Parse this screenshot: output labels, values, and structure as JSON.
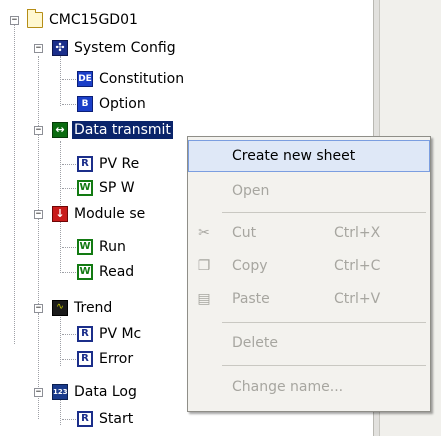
{
  "tree": {
    "root": {
      "label": "CMC15GD01",
      "icon": "folder-icon"
    },
    "nodes": [
      {
        "label": "System Config",
        "icon": "system-config-icon"
      },
      {
        "label": "Constitution",
        "icon": "constitution-icon"
      },
      {
        "label": "Option",
        "icon": "option-icon"
      },
      {
        "label": "Data transmit",
        "icon": "data-transmit-icon"
      },
      {
        "label": "PV Re",
        "icon": "read-icon",
        "badge": "R"
      },
      {
        "label": "SP W",
        "icon": "write-icon",
        "badge": "W"
      },
      {
        "label": "Module se",
        "icon": "module-icon"
      },
      {
        "label": "Run",
        "icon": "write-icon",
        "badge": "W"
      },
      {
        "label": "Read",
        "icon": "write-icon",
        "badge": "W"
      },
      {
        "label": "Trend",
        "icon": "trend-icon"
      },
      {
        "label": "PV Mc",
        "icon": "read-icon",
        "badge": "R"
      },
      {
        "label": "Error",
        "icon": "read-icon",
        "badge": "R"
      },
      {
        "label": "Data Log",
        "icon": "data-log-icon",
        "badge": "123"
      },
      {
        "label": "Start",
        "icon": "read-icon",
        "badge": "R"
      }
    ]
  },
  "context_menu": {
    "items": [
      {
        "label": "Create new sheet",
        "shortcut": "",
        "enabled": true,
        "icon": ""
      },
      {
        "label": "Open",
        "shortcut": "",
        "enabled": false,
        "icon": ""
      },
      {
        "label": "Cut",
        "shortcut": "Ctrl+X",
        "enabled": false,
        "icon": "scissors-icon"
      },
      {
        "label": "Copy",
        "shortcut": "Ctrl+C",
        "enabled": false,
        "icon": "copy-icon"
      },
      {
        "label": "Paste",
        "shortcut": "Ctrl+V",
        "enabled": false,
        "icon": "clipboard-icon"
      },
      {
        "label": "Delete",
        "shortcut": "",
        "enabled": false,
        "icon": ""
      },
      {
        "label": "Change name...",
        "shortcut": "",
        "enabled": false,
        "icon": ""
      }
    ]
  },
  "colors": {
    "selection": "#0a246a",
    "menu_highlight": "#dfe8f7",
    "disabled_text": "#a7a6a0"
  }
}
